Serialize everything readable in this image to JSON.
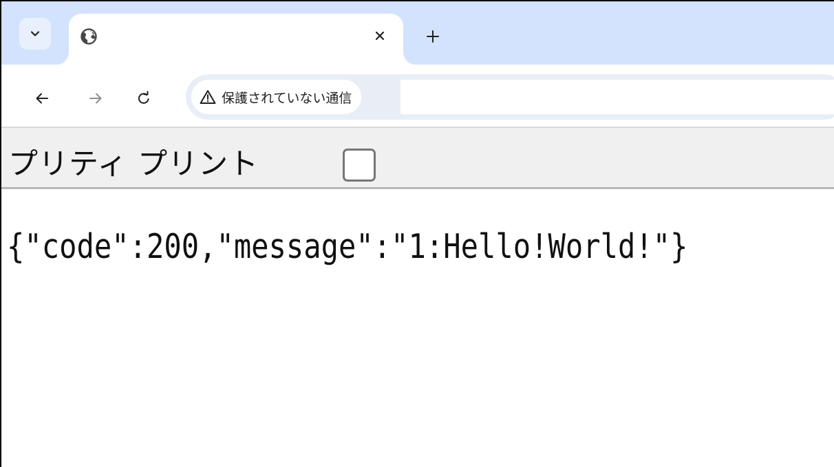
{
  "browser": {
    "tab": {
      "title": "",
      "favicon": "globe-icon",
      "close_icon": "close-icon"
    },
    "tab_search_icon": "chevron-down-icon",
    "new_tab_icon": "plus-icon",
    "toolbar": {
      "back_icon": "arrow-left-icon",
      "forward_icon": "arrow-right-icon",
      "reload_icon": "reload-icon",
      "security_icon": "warning-triangle-icon",
      "security_label": "保護されていない通信",
      "url": ""
    },
    "colors": {
      "tabstrip": "#d3e3fd",
      "omnibox": "#e9eef6",
      "pretty_bar": "#f0f0f0"
    }
  },
  "json_viewer": {
    "pretty_print_label": "プリティ プリント",
    "pretty_print_checked": false,
    "raw_json": "{\"code\":200,\"message\":\"1:Hello!World!\"}"
  }
}
